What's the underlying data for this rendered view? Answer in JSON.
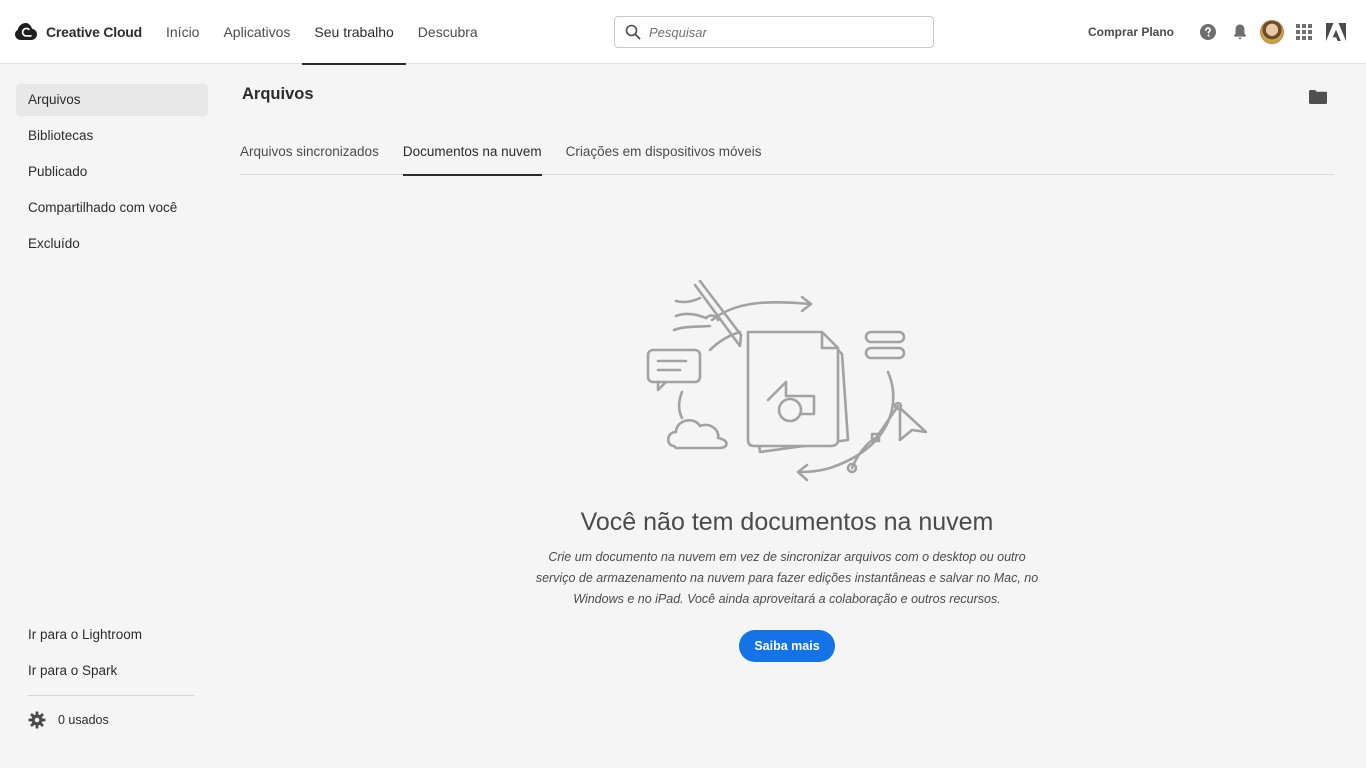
{
  "header": {
    "brand": "Creative Cloud",
    "nav": [
      "Início",
      "Aplicativos",
      "Seu trabalho",
      "Descubra"
    ],
    "active_nav": "Seu trabalho",
    "search_placeholder": "Pesquisar",
    "buy_plan": "Comprar Plano",
    "icons": [
      "help-icon",
      "bell-icon",
      "avatar",
      "apps-grid-icon",
      "adobe-logo"
    ]
  },
  "sidebar": {
    "items": [
      "Arquivos",
      "Bibliotecas",
      "Publicado",
      "Compartilhado com você",
      "Excluído"
    ],
    "active": "Arquivos",
    "links": [
      "Ir para o Lightroom",
      "Ir para o Spark"
    ],
    "usage": "0 usados"
  },
  "main": {
    "title": "Arquivos",
    "tabs": [
      "Arquivos sincronizados",
      "Documentos na nuvem",
      "Criações em dispositivos móveis"
    ],
    "active_tab": "Documentos na nuvem",
    "empty_title": "Você não tem documentos na nuvem",
    "empty_desc": "Crie um documento na nuvem em vez de sincronizar arquivos com o desktop ou outro serviço de armazenamento na nuvem para fazer edições instantâneas e salvar no Mac, no Windows e no iPad. Você ainda aproveitará a colaboração e outros recursos.",
    "cta": "Saiba mais"
  },
  "colors": {
    "accent": "#1473e6",
    "background": "#f5f5f5",
    "illustration_stroke": "#9a9a9a"
  }
}
